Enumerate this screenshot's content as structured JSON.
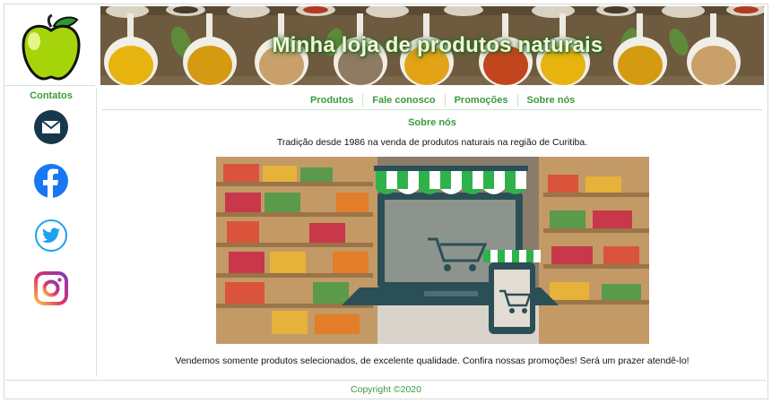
{
  "banner": {
    "title": "Minha loja de produtos naturais"
  },
  "sidebar": {
    "title": "Contatos",
    "icons": [
      "email-icon",
      "facebook-icon",
      "twitter-icon",
      "instagram-icon"
    ]
  },
  "nav": {
    "items": [
      "Produtos",
      "Fale conosco",
      "Promoções",
      "Sobre nós"
    ]
  },
  "main": {
    "section_title": "Sobre nós",
    "lead": "Tradição desde 1986 na venda de produtos naturais na região de Curitiba.",
    "bottom_text": "Vendemos somente produtos selecionados, de excelente qualidade. Confira nossas promoções! Será um prazer atendê-lo!"
  },
  "footer": {
    "copyright": "Copyright ©2020"
  },
  "colors": {
    "accent": "#3c9a3c",
    "awning_green": "#2fb24a",
    "screen_teal": "#2b4f57"
  }
}
